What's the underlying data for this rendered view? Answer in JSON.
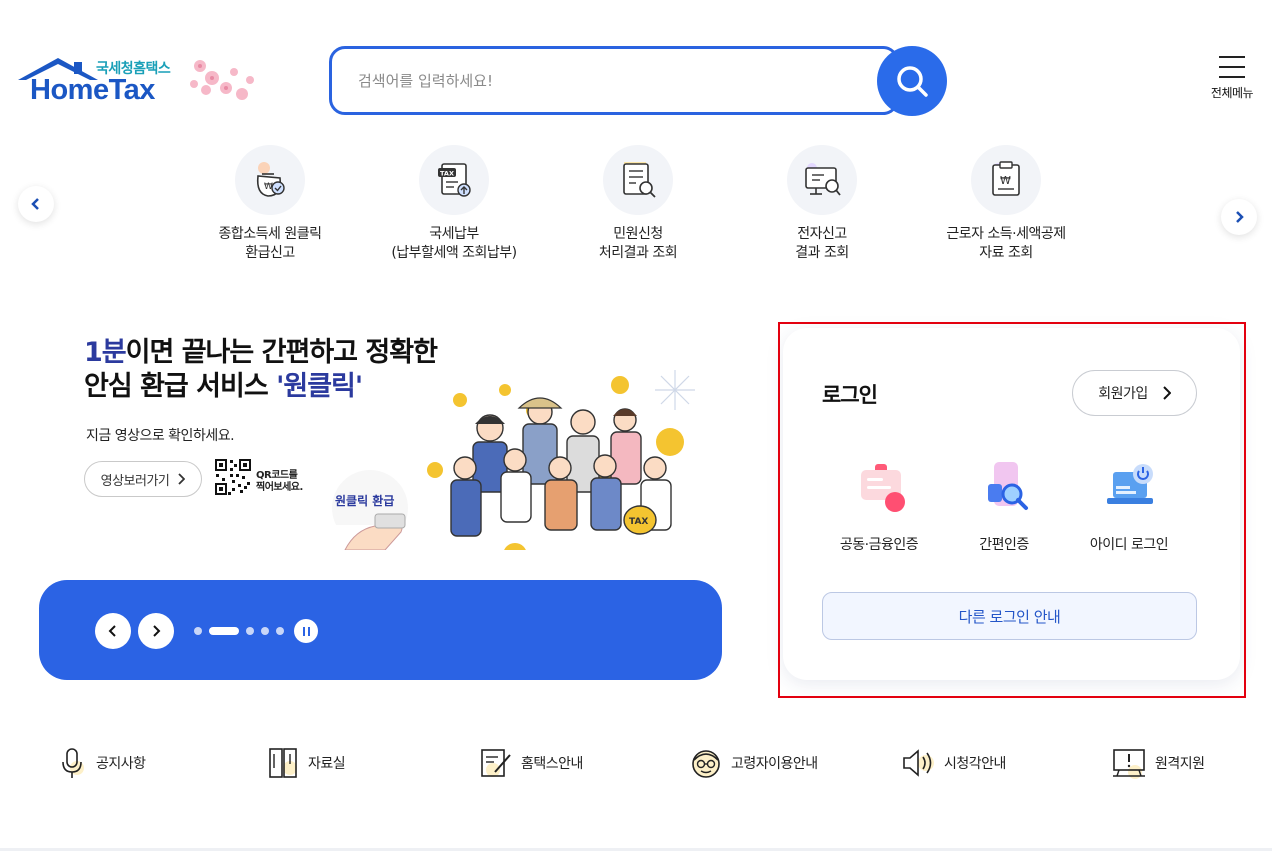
{
  "header": {
    "logo_sub": "국세청홈택스",
    "logo_main": "HomeTax",
    "search_placeholder": "검색어를 입력하세요!",
    "all_menu_label": "전체메뉴"
  },
  "quick_services": [
    {
      "line1": "종합소득세 원클릭",
      "line2": "환급신고",
      "icon": "wallet-check-icon"
    },
    {
      "line1": "국세납부",
      "line2": "(납부할세액 조회납부)",
      "icon": "tax-document-upload-icon"
    },
    {
      "line1": "민원신청",
      "line2": "처리결과 조회",
      "icon": "document-search-icon"
    },
    {
      "line1": "전자신고",
      "line2": "결과 조회",
      "icon": "monitor-search-icon"
    },
    {
      "line1": "근로자 소득·세액공제",
      "line2": "자료 조회",
      "icon": "clipboard-won-icon"
    }
  ],
  "banner": {
    "headline_accent": "1분",
    "headline_rest1": "이면 끝나는 간편하고 정확한",
    "headline_line2a": "안심 환급 서비스 ",
    "headline_line2b": "'원클릭'",
    "description": "지금 영상으로 확인하세요.",
    "video_button": "영상보러가기",
    "qr_line1": "QR코드를",
    "qr_line2": "찍어보세요.",
    "art_button_label": "원클릭 환급",
    "art_bag_label": "TAX"
  },
  "carousel": {
    "slide_count": 5,
    "active_slide": 2
  },
  "login": {
    "title": "로그인",
    "join_button": "회원가입",
    "options": [
      {
        "label": "공동·금융인증",
        "icon": "certificate-card-icon"
      },
      {
        "label": "간편인증",
        "icon": "phone-search-icon"
      },
      {
        "label": "아이디 로그인",
        "icon": "laptop-power-icon"
      }
    ],
    "other_login_button": "다른 로그인 안내"
  },
  "bottom_nav": [
    {
      "label": "공지사항",
      "icon": "microphone-icon"
    },
    {
      "label": "자료실",
      "icon": "bookshelf-icon"
    },
    {
      "label": "홈택스안내",
      "icon": "pencil-note-icon"
    },
    {
      "label": "고령자이용안내",
      "icon": "senior-face-icon"
    },
    {
      "label": "시청각안내",
      "icon": "speaker-icon"
    },
    {
      "label": "원격지원",
      "icon": "monitor-alert-icon"
    }
  ],
  "colors": {
    "brand_blue": "#2a63e0",
    "logo_teal": "#1aa0b8",
    "highlight_red": "#e3000f"
  }
}
